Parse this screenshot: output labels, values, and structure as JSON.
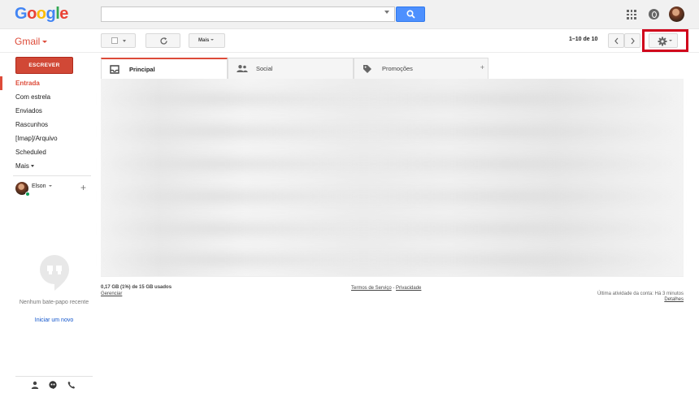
{
  "header": {
    "logo_letters": [
      {
        "char": "G",
        "color": "#4285f4"
      },
      {
        "char": "o",
        "color": "#ea4335"
      },
      {
        "char": "o",
        "color": "#fbbc05"
      },
      {
        "char": "g",
        "color": "#4285f4"
      },
      {
        "char": "l",
        "color": "#34a853"
      },
      {
        "char": "e",
        "color": "#ea4335"
      }
    ],
    "search_value": "",
    "icons": [
      "apps-icon",
      "notifications-icon",
      "account-avatar"
    ]
  },
  "toolbar": {
    "app_label": "Gmail",
    "more_label": "Mais",
    "pagination": "1–10 de 10"
  },
  "sidebar": {
    "compose_label": "ESCREVER",
    "items": [
      {
        "label": "Entrada",
        "active": true
      },
      {
        "label": "Com estrela",
        "active": false
      },
      {
        "label": "Enviados",
        "active": false
      },
      {
        "label": "Rascunhos",
        "active": false
      },
      {
        "label": "[Imap]/Arquivo",
        "active": false
      },
      {
        "label": "Scheduled",
        "active": false
      },
      {
        "label": "Mais",
        "active": false
      }
    ],
    "chat_user": "Elson",
    "no_chats_text": "Nenhum bate-papo recente",
    "start_chat_link": "Iniciar um novo"
  },
  "tabs": [
    {
      "label": "Principal",
      "icon": "inbox-icon",
      "active": true
    },
    {
      "label": "Social",
      "icon": "people-icon",
      "active": false
    },
    {
      "label": "Promoções",
      "icon": "tag-icon",
      "active": false
    }
  ],
  "footer": {
    "storage": "0,17 GB (1%) de 15 GB usados",
    "manage_link": "Gerenciar",
    "terms_link": "Termos de Serviço",
    "separator": " - ",
    "privacy_link": "Privacidade",
    "last_activity": "Última atividade da conta: Há 3 minutos",
    "details_link": "Detalhes"
  },
  "colors": {
    "accent_red": "#dd4b39",
    "compose_red": "#d14836",
    "search_blue": "#4d90fe",
    "highlight_red": "#d0021b",
    "link_blue": "#1155cc"
  }
}
